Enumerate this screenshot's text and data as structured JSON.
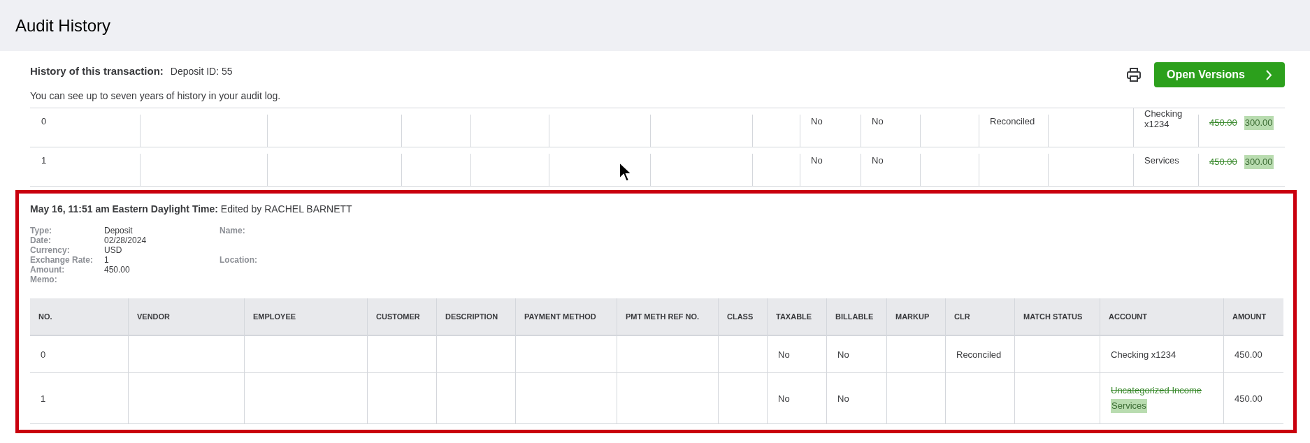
{
  "page": {
    "title": "Audit History"
  },
  "history": {
    "label": "History of this transaction:",
    "value": "Deposit ID: 55",
    "note": "You can see up to seven years of history in your audit log.",
    "open_versions_button": "Open Versions"
  },
  "previous_rows": [
    [
      "0",
      null,
      null,
      null,
      null,
      null,
      null,
      null,
      "No",
      "No",
      null,
      "Reconciled",
      null,
      "Checking x1234",
      {
        "kind": "change",
        "old": "450.00",
        "new": "300.00"
      }
    ],
    [
      "1",
      null,
      null,
      null,
      null,
      null,
      null,
      null,
      "No",
      "No",
      null,
      null,
      null,
      "Services",
      {
        "kind": "change",
        "old": "450.00",
        "new": "300.00"
      }
    ]
  ],
  "entry": {
    "highlighted": true,
    "timestamp": "May 16, 11:51 am Eastern Daylight Time:",
    "editor": "Edited by RACHEL BARNETT",
    "details": [
      {
        "label": "Type:",
        "value": "Deposit",
        "side_label": "Name:"
      },
      {
        "label": "Date:",
        "value": "02/28/2024"
      },
      {
        "label": "Currency:",
        "value": "USD"
      },
      {
        "label": "Exchange Rate:",
        "value": "1",
        "side_label": "Location:"
      },
      {
        "label": "Amount:",
        "value": "450.00"
      },
      {
        "label": "Memo:"
      }
    ],
    "table": {
      "columns": [
        "NO.",
        "VENDOR",
        "EMPLOYEE",
        "CUSTOMER",
        "DESCRIPTION",
        "PAYMENT METHOD",
        "PMT METH REF NO.",
        "CLASS",
        "TAXABLE",
        "BILLABLE",
        "MARKUP",
        "CLR",
        "MATCH STATUS",
        "ACCOUNT",
        "AMOUNT"
      ],
      "rows": [
        [
          "0",
          null,
          null,
          null,
          null,
          null,
          null,
          null,
          "No",
          "No",
          null,
          "Reconciled",
          null,
          "Checking x1234",
          "450.00"
        ],
        [
          "1",
          null,
          null,
          null,
          null,
          null,
          null,
          null,
          "No",
          "No",
          null,
          null,
          null,
          {
            "kind": "change",
            "old": "Uncategorized Income",
            "new": "Services"
          },
          "450.00"
        ]
      ]
    }
  }
}
